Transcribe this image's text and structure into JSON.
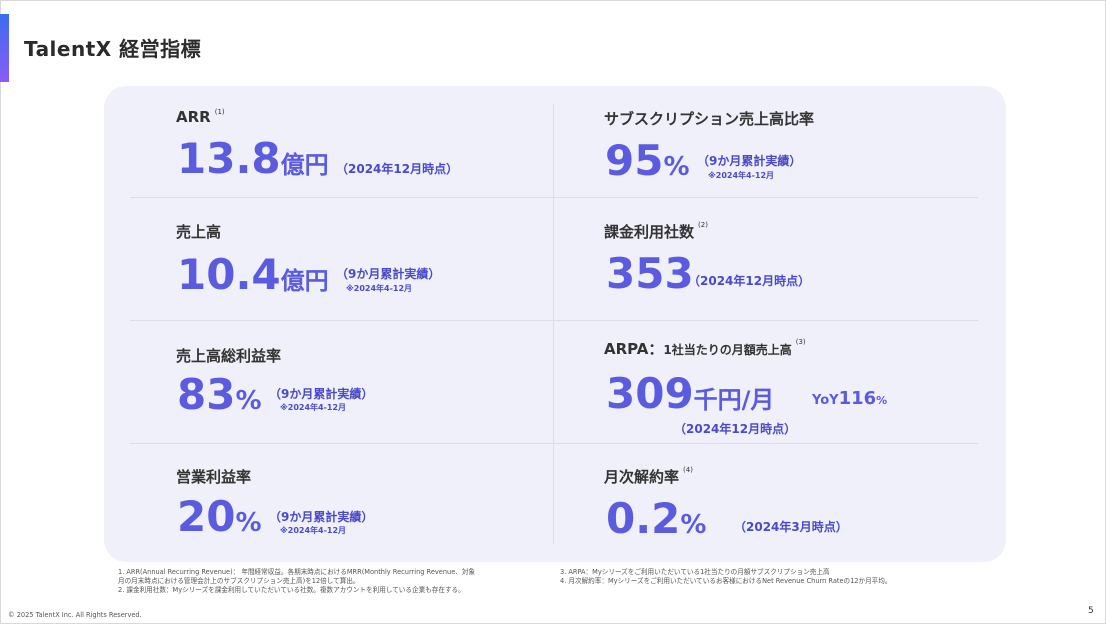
{
  "title": "TalentX 経営指標",
  "metrics": [
    {
      "label": "ARR",
      "note": "(1)",
      "value": "13.8",
      "unit": "億円",
      "sub": "（2024年12月時点）"
    },
    {
      "label": "サブスクリプション売上高比率",
      "value": "95",
      "unit": "%",
      "sub": "（9か月累計実績）",
      "sub2": "※2024年4-12月"
    },
    {
      "label": "売上高",
      "value": "10.4",
      "unit": "億円",
      "sub": "（9か月累計実績）",
      "sub2": "※2024年4-12月"
    },
    {
      "label": "課金利用社数",
      "note": "(2)",
      "value": "353",
      "sub": "（2024年12月時点）"
    },
    {
      "label": "売上高総利益率",
      "value": "83",
      "unit": "%",
      "sub": "（9か月累計実績）",
      "sub2": "※2024年4-12月"
    },
    {
      "label": "ARPA：",
      "label_small": "1社当たりの月額売上高",
      "note": "(3)",
      "value": "309",
      "unit": "千円/月",
      "yoy_label": "YoY",
      "yoy_value": "116",
      "yoy_unit": "%",
      "sub": "（2024年12月時点）"
    },
    {
      "label": "営業利益率",
      "value": "20",
      "unit": "%",
      "sub": "（9か月累計実績）",
      "sub2": "※2024年4-12月"
    },
    {
      "label": "月次解約率",
      "note": "(4)",
      "value": "0.2",
      "unit": "%",
      "sub": "（2024年3月時点）"
    }
  ],
  "footnotes_left": [
    "1. ARR(Annual Recurring Revenue)： 年間経常収益。各期末時点におけるMRR(Monthly Recurring Revenue、対象",
    "月の月末時点における管理会計上のサブスクリプション売上高)を12倍して算出。",
    "2. 課金利用社数：Myシリーズを課金利用していただいている社数。複数アカウントを利用している企業も存在する。"
  ],
  "footnotes_right": [
    "3. ARPA：Myシリーズをご利用いただいている1社当たりの月額サブスクリプション売上高",
    "4. 月次解約率：Myシリーズをご利用いただいているお客様におけるNet Revenue Churn Rateの12か月平均。"
  ],
  "copyright": "© 2025 TalentX Inc. All Rights Reserved.",
  "page_number": "5"
}
